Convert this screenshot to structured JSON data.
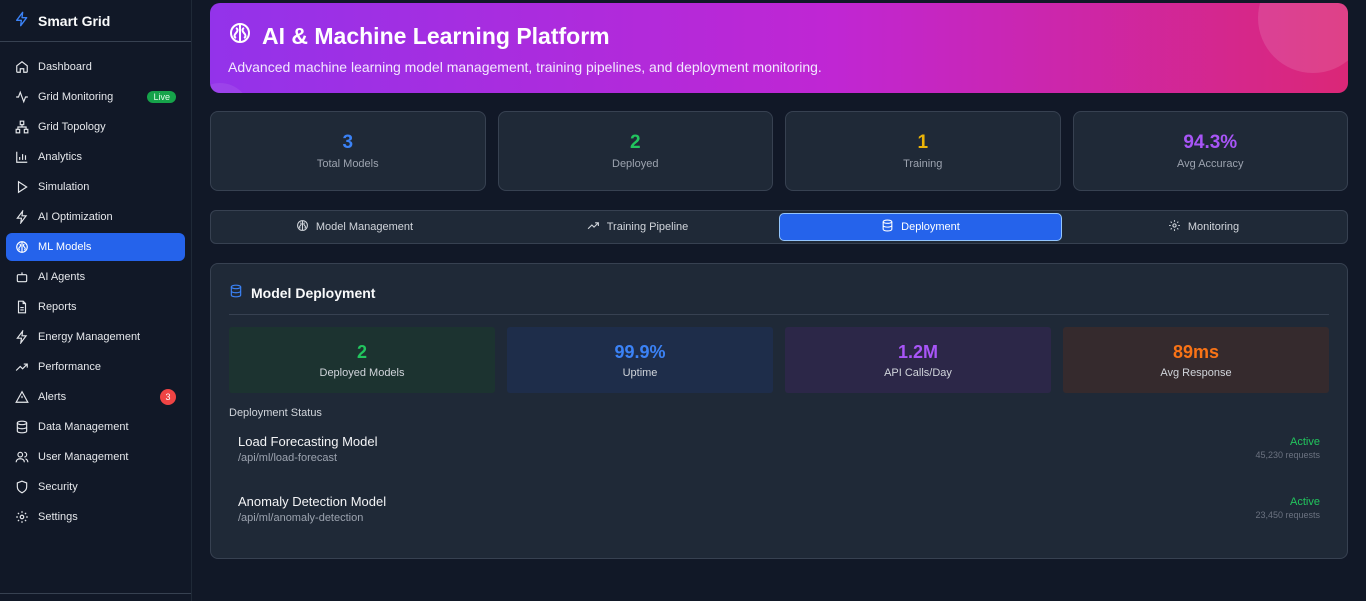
{
  "brand": {
    "name": "Smart Grid"
  },
  "sidebar": {
    "items": [
      {
        "label": "Dashboard",
        "icon": "home-icon"
      },
      {
        "label": "Grid Monitoring",
        "icon": "activity-icon",
        "badge": "Live"
      },
      {
        "label": "Grid Topology",
        "icon": "network-icon"
      },
      {
        "label": "Analytics",
        "icon": "bar-chart-icon"
      },
      {
        "label": "Simulation",
        "icon": "play-icon"
      },
      {
        "label": "AI Optimization",
        "icon": "zap-icon"
      },
      {
        "label": "ML Models",
        "icon": "brain-icon",
        "active": true
      },
      {
        "label": "AI Agents",
        "icon": "bot-icon"
      },
      {
        "label": "Reports",
        "icon": "file-text-icon"
      },
      {
        "label": "Energy Management",
        "icon": "zap-icon"
      },
      {
        "label": "Performance",
        "icon": "trending-up-icon"
      },
      {
        "label": "Alerts",
        "icon": "alert-triangle-icon",
        "count": "3"
      },
      {
        "label": "Data Management",
        "icon": "database-icon"
      },
      {
        "label": "User Management",
        "icon": "users-icon"
      },
      {
        "label": "Security",
        "icon": "shield-icon"
      },
      {
        "label": "Settings",
        "icon": "gear-icon"
      }
    ]
  },
  "hero": {
    "title": "AI & Machine Learning Platform",
    "subtitle": "Advanced machine learning model management, training pipelines, and deployment monitoring."
  },
  "stats": [
    {
      "value": "3",
      "label": "Total Models",
      "color": "#3b82f6"
    },
    {
      "value": "2",
      "label": "Deployed",
      "color": "#22c55e"
    },
    {
      "value": "1",
      "label": "Training",
      "color": "#eab308"
    },
    {
      "value": "94.3%",
      "label": "Avg Accuracy",
      "color": "#a855f7"
    }
  ],
  "tabs": [
    {
      "label": "Model Management",
      "icon": "brain-icon"
    },
    {
      "label": "Training Pipeline",
      "icon": "trending-up-icon"
    },
    {
      "label": "Deployment",
      "icon": "database-icon",
      "active": true
    },
    {
      "label": "Monitoring",
      "icon": "gear-icon"
    }
  ],
  "panel": {
    "title": "Model Deployment",
    "metrics": [
      {
        "value": "2",
        "label": "Deployed Models",
        "color": "#22c55e",
        "bg": "#1c3330"
      },
      {
        "value": "99.9%",
        "label": "Uptime",
        "color": "#3b82f6",
        "bg": "#1e2d4a"
      },
      {
        "value": "1.2M",
        "label": "API Calls/Day",
        "color": "#a855f7",
        "bg": "#2c2748"
      },
      {
        "value": "89ms",
        "label": "Avg Response",
        "color": "#f97316",
        "bg": "#352a2d"
      }
    ],
    "section_label": "Deployment Status",
    "deployments": [
      {
        "name": "Load Forecasting Model",
        "path": "/api/ml/load-forecast",
        "status": "Active",
        "requests": "45,230 requests"
      },
      {
        "name": "Anomaly Detection Model",
        "path": "/api/ml/anomaly-detection",
        "status": "Active",
        "requests": "23,450 requests"
      }
    ]
  }
}
